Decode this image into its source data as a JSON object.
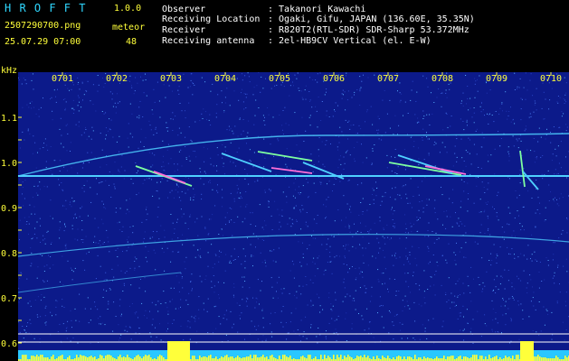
{
  "header": {
    "app_title": "H R O F F T",
    "version": "1.0.0",
    "filename": "2507290700.png",
    "datetime": "25.07.29 07:00",
    "meteor_label": "meteor",
    "meteor_count": "48",
    "info": [
      {
        "label": "Observer",
        "value": ": Takanori Kawachi"
      },
      {
        "label": "Receiving Location",
        "value": ": Ogaki, Gifu, JAPAN (136.60E, 35.35N)"
      },
      {
        "label": "Receiver",
        "value": ": R820T2(RTL-SDR) SDR-Sharp 53.372MHz"
      },
      {
        "label": "Receiving antenna",
        "value": ": 2el-HB9CV Vertical (el. E-W)"
      }
    ]
  },
  "spectrogram": {
    "unit_label": "kHz",
    "time_ticks": [
      "0701",
      "0702",
      "0703",
      "0704",
      "0705",
      "0706",
      "0707",
      "0708",
      "0709",
      "0710"
    ],
    "freq_ticks": [
      "1.1",
      "1.0",
      "0.9",
      "0.8",
      "0.7",
      "0.6"
    ],
    "colors": {
      "background": "#0c1a8a",
      "trace": "#4fd0ff",
      "noise": "#ffff3a"
    }
  }
}
